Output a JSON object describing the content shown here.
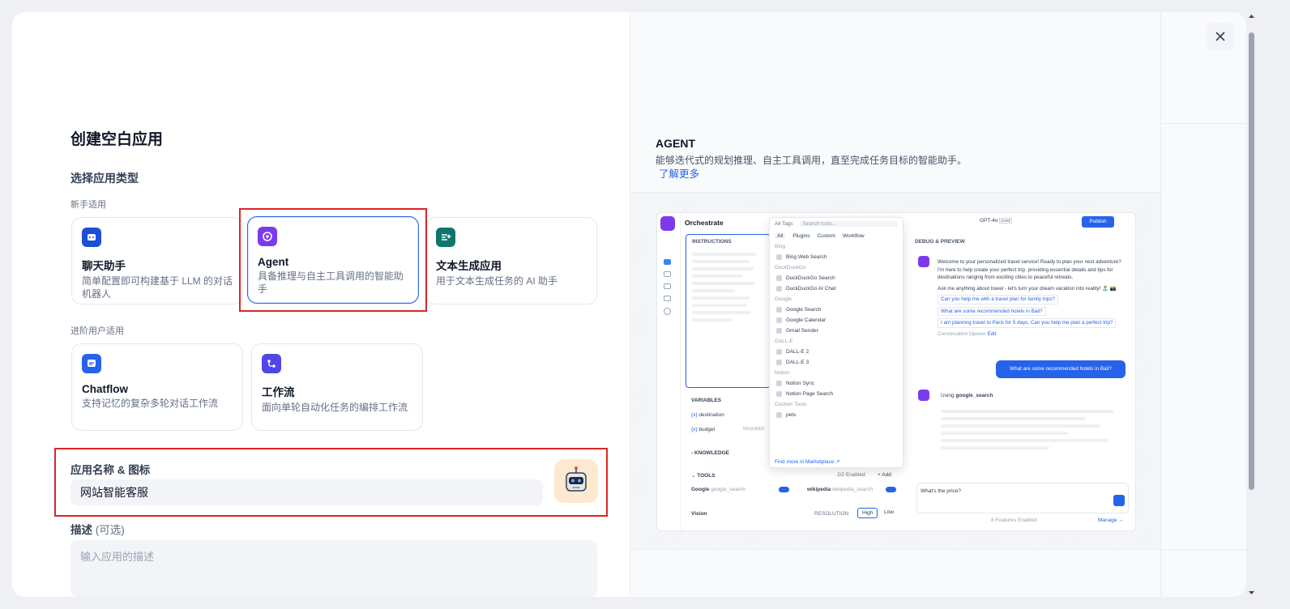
{
  "modal": {
    "title": "创建空白应用",
    "type_section": "选择应用类型",
    "beginner_label": "新手适用",
    "advanced_label": "进阶用户适用",
    "app_types": [
      {
        "name": "聊天助手",
        "desc": "简单配置即可构建基于 LLM 的对话机器人",
        "icon": "chat-bot-icon",
        "color": "#1d4ed8"
      },
      {
        "name": "Agent",
        "desc": "具备推理与自主工具调用的智能助手",
        "icon": "agent-icon",
        "color": "#7c3aed"
      },
      {
        "name": "文本生成应用",
        "desc": "用于文本生成任务的 AI 助手",
        "icon": "text-gen-icon",
        "color": "#0f766e"
      },
      {
        "name": "Chatflow",
        "desc": "支持记忆的复杂多轮对话工作流",
        "icon": "chatflow-icon",
        "color": "#2563eb"
      },
      {
        "name": "工作流",
        "desc": "面向单轮自动化任务的编排工作流",
        "icon": "workflow-icon",
        "color": "#4f46e5"
      }
    ],
    "name_icon_label": "应用名称 & 图标",
    "app_name_value": "网站智能客服",
    "description_label": "描述",
    "description_optional": "(可选)",
    "description_placeholder": "输入应用的描述"
  },
  "preview": {
    "title": "AGENT",
    "desc": "能够迭代式的规划推理、自主工具调用，直至完成任务目标的智能助手。",
    "learn_more": "了解更多",
    "app": {
      "orchestrate": "Orchestrate",
      "instructions": "INSTRUCTIONS",
      "variables": "VARIABLES",
      "var1": "destination",
      "var2": "budget",
      "required": "REQUIRED",
      "knowledge": "KNOWLEDGE",
      "tools": "TOOLS",
      "tools_enabled": "2/2 Enabled",
      "add": "+ Add",
      "tool1": "Google",
      "tool1_sub": "google_search",
      "tool2": "wikipedia",
      "tool2_sub": "wikipedia_search",
      "vision": "Vision",
      "resolution": "RESOLUTION",
      "high": "High",
      "low": "Low",
      "all_tags": "All Tags",
      "search_tools": "Search tools...",
      "tabs": [
        "All",
        "Plugins",
        "Custom",
        "Workflow"
      ],
      "groups": [
        {
          "name": "Bing",
          "items": [
            "Bing Web Search"
          ]
        },
        {
          "name": "DuckDuckGo",
          "items": [
            "DuckDuckGo Search",
            "DuckDuckGo AI Chat"
          ]
        },
        {
          "name": "Google",
          "items": [
            "Google Search",
            "Google Calendar",
            "Gmail Sender"
          ]
        },
        {
          "name": "DALL-E",
          "items": [
            "DALL-E 2",
            "DALL-E 3"
          ]
        },
        {
          "name": "Notion",
          "items": [
            "Notion Sync",
            "Notion Page Search"
          ]
        },
        {
          "name": "Custom Tools",
          "items": [
            "pets"
          ]
        }
      ],
      "find_more": "Find more in",
      "marketplace": "Marketplace ↗",
      "model": "GPT-4o",
      "chat_badge": "CHAT",
      "publish": "Publish",
      "debug": "DEBUG & PREVIEW",
      "welcome": "Welcome to your personalized travel service! Ready to plan your next adventure? I'm here to help create your perfect trip, providing essential details and tips for destinations ranging from exciting cities to peaceful retreats.",
      "ask": "Ask me anything about travel - let's turn your dream vacation into reality! 🏝️ 📸",
      "suggestions": [
        "Can you help me with a travel plan for family trips?",
        "What are some recommended hotels in Bali?",
        "I am planning travel to Paris for 5 days. Can you help me plan a perfect trip?"
      ],
      "opener": "Conversation Opener",
      "edit": "Edit",
      "user_msg": "What are some recommended hotels in Bali?",
      "using": "Using",
      "using_tool": "google_search",
      "input_text": "What's the price?",
      "features": "8 Features Enabled",
      "manage": "Manage →"
    }
  }
}
